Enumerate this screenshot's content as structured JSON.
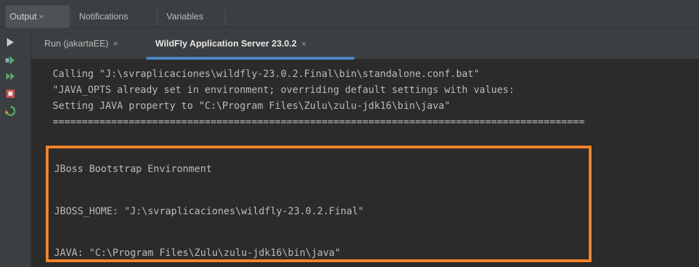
{
  "tool_tabs": [
    {
      "label": "Output",
      "close": "×",
      "active": true
    },
    {
      "label": "Notifications",
      "active": false
    },
    {
      "label": "Variables",
      "active": false
    }
  ],
  "run_tabs": [
    {
      "label": "Run (jakartaEE)",
      "close": "×",
      "active": false
    },
    {
      "label": "WildFly Application Server 23.0.2",
      "close": "×",
      "active": true
    }
  ],
  "toolbar_icons": [
    "run-icon",
    "rerun-icon",
    "resume-icon",
    "stop-icon",
    "restart-server-icon"
  ],
  "console": {
    "lines": [
      "Calling \"J:\\svraplicaciones\\wildfly-23.0.2.Final\\bin\\standalone.conf.bat\"",
      "\"JAVA_OPTS already set in environment; overriding default settings with values:",
      "Setting JAVA property to \"C:\\Program Files\\Zulu\\zulu-jdk16\\bin\\java\"",
      "==========================================================================================="
    ],
    "bootstrap": {
      "title": "JBoss Bootstrap Environment",
      "jboss_home": "JBOSS_HOME: \"J:\\svraplicaciones\\wildfly-23.0.2.Final\"",
      "java": "JAVA: \"C:\\Program Files\\Zulu\\zulu-jdk16\\bin\\java\""
    }
  },
  "colors": {
    "background": "#2b2b2b",
    "panel": "#3c3f41",
    "text": "#bbbbbb",
    "highlight_border": "#f58529",
    "active_tab_underline": "#4a88c7",
    "run_green": "#59a869",
    "stop_red": "#c75450"
  }
}
